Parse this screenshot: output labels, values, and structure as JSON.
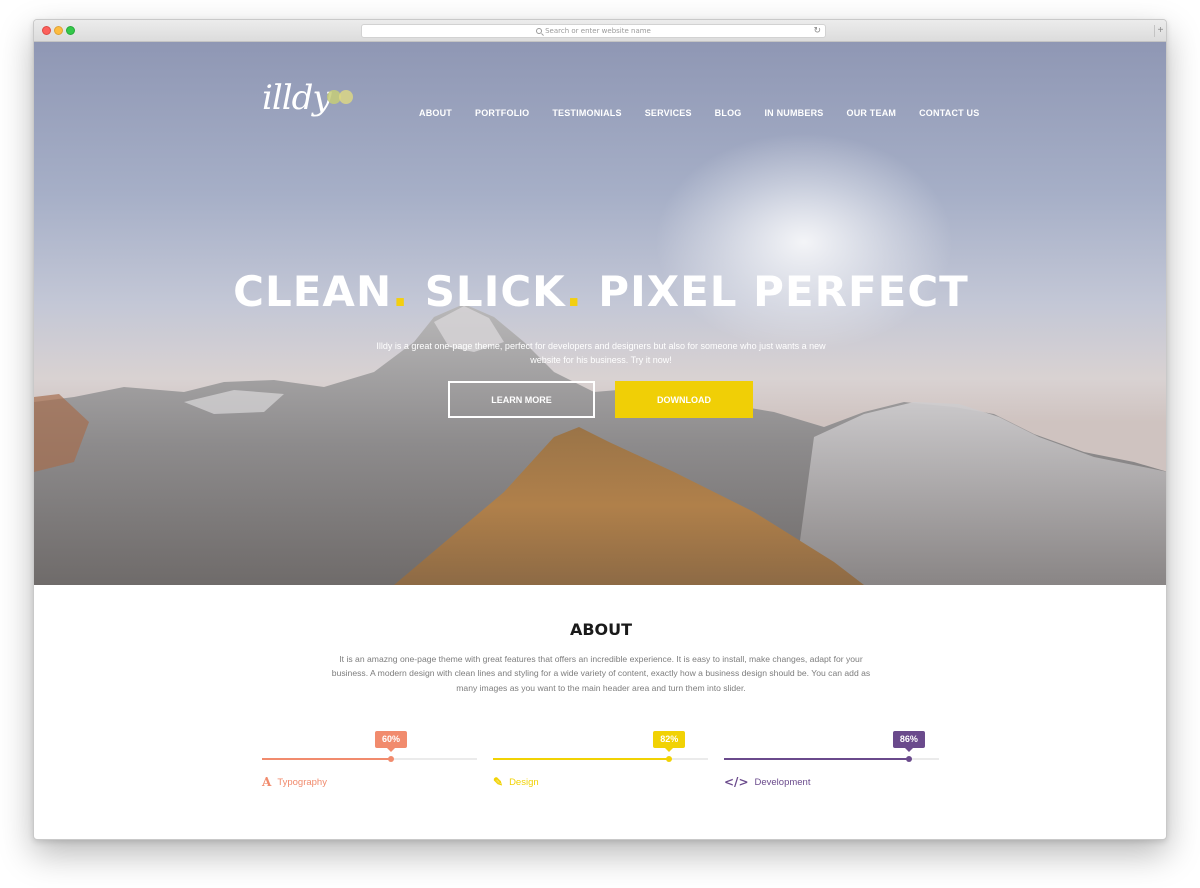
{
  "browser": {
    "url_placeholder": "Search or enter website name"
  },
  "header": {
    "logo": "illdy",
    "nav": [
      "ABOUT",
      "PORTFOLIO",
      "TESTIMONIALS",
      "SERVICES",
      "BLOG",
      "IN NUMBERS",
      "OUR TEAM",
      "CONTACT US"
    ]
  },
  "hero": {
    "headline_1": "CLEAN",
    "headline_2": "SLICK",
    "headline_3": "PIXEL PERFECT",
    "headline_dot": ".",
    "tagline": "Illdy is a great one-page theme, perfect for developers and designers but also for someone who just wants a new website for his business. Try it now!",
    "learn_more": "LEARN MORE",
    "download": "DOWNLOAD"
  },
  "about": {
    "title": "ABOUT",
    "text": "It is an amazng one-page theme with great features that offers an incredible experience. It is easy to install, make changes, adapt for your business. A modern design with clean lines and styling for a wide variety of content, exactly how a business design should be. You can add as many images as you want to the main header area and turn them into slider.",
    "skills": [
      {
        "name": "Typography",
        "percent_label": "60%",
        "value": 60,
        "color": "#f18b6d",
        "icon": "typography-icon"
      },
      {
        "name": "Design",
        "percent_label": "82%",
        "value": 82,
        "color": "#f1d204",
        "icon": "pencil-icon"
      },
      {
        "name": "Development",
        "percent_label": "86%",
        "value": 86,
        "color": "#6a4a8c",
        "icon": "code-icon"
      }
    ]
  }
}
